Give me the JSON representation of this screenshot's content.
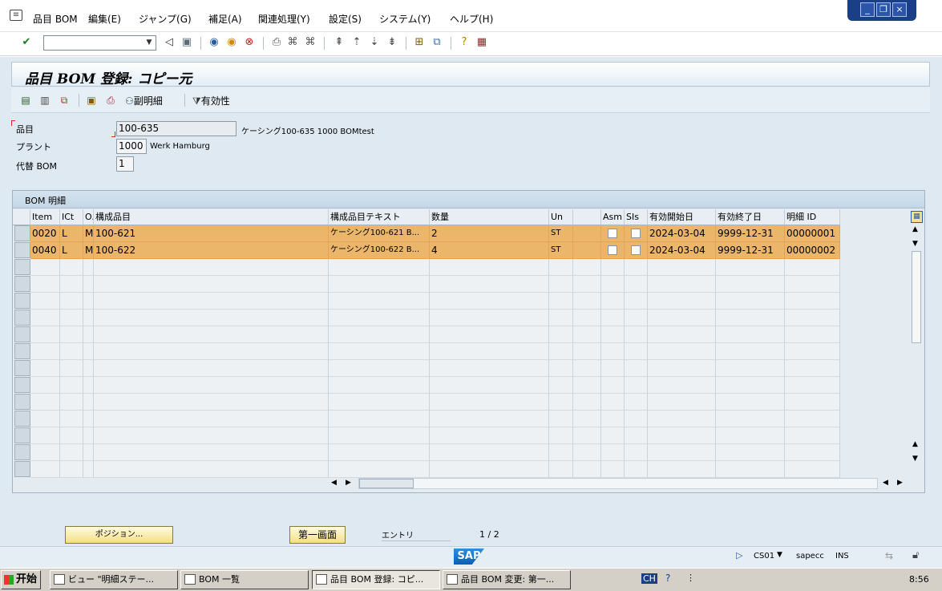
{
  "menu": {
    "items": [
      "品目 BOM",
      "編集(E)",
      "ジャンプ(G)",
      "補足(A)",
      "関連処理(Y)",
      "設定(S)",
      "システム(Y)",
      "ヘルプ(H)"
    ]
  },
  "window_controls": [
    "minimize",
    "restore",
    "close"
  ],
  "toolbar": {
    "command_value": "",
    "icons": [
      "enter-icon",
      "back-arrow-icon",
      "save-icon",
      "back-icon",
      "exit-icon",
      "cancel-icon",
      "print-icon",
      "find-icon",
      "find-next-icon",
      "first-page-icon",
      "prev-page-icon",
      "next-page-icon",
      "last-page-icon",
      "new-session-icon",
      "shortcut-icon",
      "help-icon",
      "layout-icon"
    ]
  },
  "page": {
    "title": "品目 BOM 登録: コピー元"
  },
  "app_toolbar": {
    "icons": [
      "details-icon",
      "select-all-icon",
      "copy-icon",
      "sub-items-icon",
      "print-list-icon"
    ],
    "sub_items_label": "副明細",
    "filter_label": "有効性"
  },
  "header_fields": {
    "material_label": "品目",
    "material_value": "100-635",
    "material_desc": "ケーシング100-635 1000 BOMtest",
    "plant_label": "プラント",
    "plant_value": "1000",
    "plant_desc": "Werk Hamburg",
    "alt_bom_label": "代替 BOM",
    "alt_bom_value": "1"
  },
  "table": {
    "caption": "BOM 明細",
    "columns": [
      "Item",
      "ICt",
      "O.",
      "構成品目",
      "構成品目テキスト",
      "数量",
      "Un",
      "",
      "Asm",
      "SIs",
      "有効開始日",
      "有効終了日",
      "明細 ID"
    ],
    "rows": [
      {
        "item": "0020",
        "ict": "L",
        "o": "M",
        "component": "100-621",
        "text": "ケーシング100-621 B...",
        "qty": "2",
        "un": "ST",
        "asm": false,
        "sis": false,
        "valid_from": "2024-03-04",
        "valid_to": "9999-12-31",
        "id": "00000001"
      },
      {
        "item": "0040",
        "ict": "L",
        "o": "M",
        "component": "100-622",
        "text": "ケーシング100-622 B...",
        "qty": "4",
        "un": "ST",
        "asm": false,
        "sis": false,
        "valid_from": "2024-03-04",
        "valid_to": "9999-12-31",
        "id": "00000002"
      }
    ],
    "empty_rows": 13
  },
  "bottom": {
    "position_button": "ポジション...",
    "first_screen_button": "第一画面",
    "entry_label": "エントリ",
    "entry_count": "1 / 2"
  },
  "status": {
    "logo": "SAP",
    "transaction": "CS01",
    "system": "sapecc",
    "mode": "INS"
  },
  "taskbar": {
    "start": "开始",
    "tasks": [
      "ビュー \"明細ステー...",
      "BOM 一覧",
      "品目 BOM 登録: コピ...",
      "品目 BOM 変更: 第一..."
    ],
    "tray_lang": "CH",
    "clock": "8:56"
  },
  "colors": {
    "selected_row": "#ebb56a",
    "background": "#dfe9f2",
    "button_yellow": "#f3df84"
  }
}
